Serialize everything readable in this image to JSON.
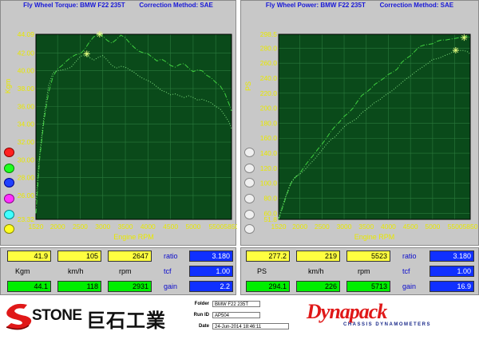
{
  "torque_panel": {
    "title": "Fly Wheel Torque: BMW F22 235T        Correction Method: SAE",
    "ylabel": "Kgm",
    "xlabel": "Engine RPM",
    "yticks": [
      "44.09",
      "42.00",
      "40.00",
      "38.00",
      "36.00",
      "34.00",
      "32.00",
      "30.00",
      "28.00",
      "26.00",
      "23.32"
    ],
    "xticks": [
      "1520",
      "2000",
      "2500",
      "3000",
      "3500",
      "4000",
      "4500",
      "5000",
      "55005850"
    ]
  },
  "power_panel": {
    "title": "Fly Wheel Power: BMW F22 235T        Correction Method: SAE",
    "ylabel": "PS",
    "xlabel": "Engine RPM",
    "yticks": [
      "298.5",
      "280.0",
      "260.0",
      "240.0",
      "220.0",
      "200.0",
      "180.0",
      "160.0",
      "140.0",
      "120.0",
      "100.0",
      "80.0",
      "60.0",
      "51.8"
    ],
    "xticks": [
      "1520",
      "2000",
      "2500",
      "3000",
      "3500",
      "4000",
      "4500",
      "5000",
      "55005850"
    ]
  },
  "chart_data": [
    {
      "type": "line",
      "title": "Fly Wheel Torque: BMW F22 235T        Correction Method: SAE",
      "xlabel": "Engine RPM",
      "ylabel": "Kgm",
      "xlim": [
        1520,
        5850
      ],
      "ylim": [
        23.32,
        44.09
      ],
      "grid": true,
      "series": [
        {
          "color": "#40d040",
          "style": "dash-dot",
          "x": [
            1520,
            1600,
            1700,
            1800,
            1900,
            2000,
            2100,
            2200,
            2300,
            2400,
            2500,
            2600,
            2700,
            2800,
            2900,
            3000,
            3100,
            3200,
            3300,
            3400,
            3500,
            3600,
            3700,
            3800,
            3900,
            4000,
            4100,
            4200,
            4300,
            4400,
            4500,
            4600,
            4700,
            4800,
            4900,
            5000,
            5100,
            5200,
            5300,
            5400,
            5500,
            5600,
            5700,
            5800,
            5850
          ],
          "y": [
            24.0,
            30.0,
            34.5,
            37.5,
            39.4,
            40.2,
            40.6,
            41.1,
            41.5,
            41.8,
            41.9,
            42.4,
            43.2,
            43.8,
            44.09,
            43.9,
            43.4,
            43.1,
            43.5,
            44.0,
            43.7,
            43.1,
            42.6,
            42.2,
            42.0,
            41.9,
            41.5,
            41.1,
            41.3,
            41.0,
            40.6,
            40.4,
            40.7,
            40.8,
            40.3,
            39.9,
            40.1,
            40.0,
            39.5,
            39.2,
            38.7,
            38.3,
            37.5,
            36.2,
            35.5
          ]
        },
        {
          "color": "#80e080",
          "style": "dot",
          "x": [
            1520,
            1600,
            1700,
            1800,
            1900,
            2000,
            2100,
            2200,
            2300,
            2400,
            2500,
            2600,
            2700,
            2800,
            2900,
            3000,
            3100,
            3200,
            3300,
            3400,
            3500,
            3600,
            3700,
            3800,
            3900,
            4000,
            4100,
            4200,
            4300,
            4400,
            4500,
            4600,
            4700,
            4800,
            4900,
            5000,
            5100,
            5200,
            5300,
            5400,
            5500,
            5600,
            5700,
            5800,
            5850
          ],
          "y": [
            25.5,
            30.5,
            35.0,
            38.3,
            39.8,
            40.0,
            40.1,
            40.2,
            40.4,
            41.0,
            41.6,
            41.8,
            41.5,
            41.2,
            41.5,
            41.7,
            41.2,
            40.6,
            40.3,
            40.5,
            40.4,
            40.1,
            39.8,
            39.4,
            39.1,
            38.9,
            38.6,
            38.2,
            37.8,
            37.6,
            37.3,
            37.4,
            37.2,
            37.0,
            37.2,
            37.0,
            36.7,
            36.8,
            36.6,
            36.4,
            36.0,
            35.7,
            35.0,
            34.2,
            33.5
          ]
        }
      ],
      "markers": [
        {
          "x": 2647,
          "y": 41.9
        },
        {
          "x": 2931,
          "y": 44.1
        }
      ]
    },
    {
      "type": "line",
      "title": "Fly Wheel Power: BMW F22 235T        Correction Method: SAE",
      "xlabel": "Engine RPM",
      "ylabel": "PS",
      "xlim": [
        1520,
        5850
      ],
      "ylim": [
        51.8,
        298.5
      ],
      "grid": true,
      "series": [
        {
          "color": "#40d040",
          "style": "dash-dot",
          "x": [
            1520,
            1600,
            1700,
            1800,
            1900,
            2000,
            2100,
            2200,
            2300,
            2400,
            2500,
            2600,
            2700,
            2800,
            2900,
            3000,
            3100,
            3200,
            3300,
            3400,
            3500,
            3600,
            3700,
            3800,
            3900,
            4000,
            4100,
            4200,
            4300,
            4400,
            4500,
            4600,
            4700,
            4800,
            4900,
            5000,
            5100,
            5200,
            5300,
            5400,
            5500,
            5600,
            5700,
            5800,
            5850
          ],
          "y": [
            52,
            66,
            84,
            100,
            108,
            113,
            122,
            130,
            137,
            145,
            152,
            160,
            169,
            176,
            182,
            189,
            194,
            200,
            209,
            217,
            221,
            226,
            232,
            236,
            240,
            245,
            248,
            252,
            261,
            266,
            270,
            276,
            282,
            284,
            285,
            286,
            289,
            291,
            291,
            292,
            293,
            294,
            295,
            296,
            293
          ]
        },
        {
          "color": "#80e080",
          "style": "dot",
          "x": [
            1520,
            1600,
            1700,
            1800,
            1900,
            2000,
            2100,
            2200,
            2300,
            2400,
            2500,
            2600,
            2700,
            2800,
            2900,
            3000,
            3100,
            3200,
            3300,
            3400,
            3500,
            3600,
            3700,
            3800,
            3900,
            4000,
            4100,
            4200,
            4300,
            4400,
            4500,
            4600,
            4700,
            4800,
            4900,
            5000,
            5100,
            5200,
            5300,
            5400,
            5500,
            5600,
            5700,
            5800,
            5850
          ],
          "y": [
            54,
            68,
            86,
            101,
            109,
            112,
            117,
            124,
            130,
            137,
            144,
            152,
            158,
            162,
            169,
            175,
            180,
            183,
            187,
            194,
            198,
            203,
            208,
            211,
            216,
            220,
            224,
            229,
            234,
            239,
            243,
            248,
            252,
            256,
            260,
            265,
            266,
            268,
            271,
            273,
            277,
            277,
            277,
            275,
            272
          ]
        }
      ],
      "markers": [
        {
          "x": 5523,
          "y": 277.2
        },
        {
          "x": 5713,
          "y": 294.1
        }
      ]
    }
  ],
  "left_readout": {
    "row1": [
      "41.9",
      "105",
      "2647"
    ],
    "row2": [
      "44.1",
      "118",
      "2931"
    ],
    "units": [
      "Kgm",
      "km/h",
      "rpm"
    ],
    "ratio_label": "ratio",
    "ratio_value": "3.180",
    "tcf_label": "tcf",
    "tcf_value": "1.00",
    "gain_label": "gain",
    "gain_value": "2.2"
  },
  "right_readout": {
    "row1": [
      "277.2",
      "219",
      "5523"
    ],
    "row2": [
      "294.1",
      "226",
      "5713"
    ],
    "units": [
      "PS",
      "km/h",
      "rpm"
    ],
    "ratio_label": "ratio",
    "ratio_value": "3.180",
    "tcf_label": "tcf",
    "tcf_value": "1.00",
    "gain_label": "gain",
    "gain_value": "16.9"
  },
  "info": {
    "folder_label": "Folder",
    "folder_value": "BMW F22 235T",
    "runid_label": "Run ID",
    "runid_value": "AP504",
    "date_label": "Date",
    "date_value": "24-Jun-2014  18:46:11"
  },
  "logos": {
    "stone_text": "STONE",
    "stone_cjk": "巨石工業",
    "dynapack_text": "Dynapack",
    "dynapack_sub": "CHASSIS DYNAMOMETERS"
  },
  "colors": {
    "panel_bg": "#c8c8c8",
    "plot_bg": "#0a4a1a",
    "grid": "#2b7a3d",
    "axis_text": "#e8e800",
    "title_text": "#1818d8",
    "series_main": "#40d040",
    "series_alt": "#80e080",
    "yellow_box": "#ffff40",
    "green_box": "#00ee00",
    "blue_box": "#1030ff"
  }
}
